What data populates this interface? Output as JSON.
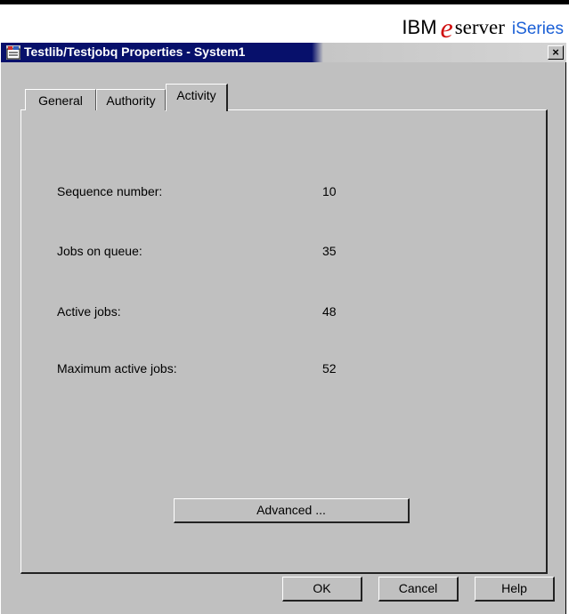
{
  "branding": {
    "ibm": "IBM",
    "eserver_e": "e",
    "eserver": "server",
    "iseries": "iSeries",
    "colors": {
      "e_logo": "#d01010",
      "iseries": "#1a5fd6"
    }
  },
  "window": {
    "title": "Testlib/Testjobq Properties - System1",
    "close_glyph": "×",
    "colors": {
      "titlebar": "#07106b",
      "face": "#c0c0c0"
    }
  },
  "tabs": [
    {
      "label": "General",
      "active": false
    },
    {
      "label": "Authority",
      "active": false
    },
    {
      "label": "Activity",
      "active": true
    }
  ],
  "activity": {
    "sequence_number": {
      "label": "Sequence number:",
      "value": "10"
    },
    "jobs_on_queue": {
      "label": "Jobs on queue:",
      "value": "35"
    },
    "active_jobs": {
      "label": "Active jobs:",
      "value": "48"
    },
    "maximum_active_jobs": {
      "label": "Maximum active jobs:",
      "value": "52"
    },
    "advanced_label": "Advanced ..."
  },
  "buttons": {
    "ok": "OK",
    "cancel": "Cancel",
    "help": "Help"
  }
}
